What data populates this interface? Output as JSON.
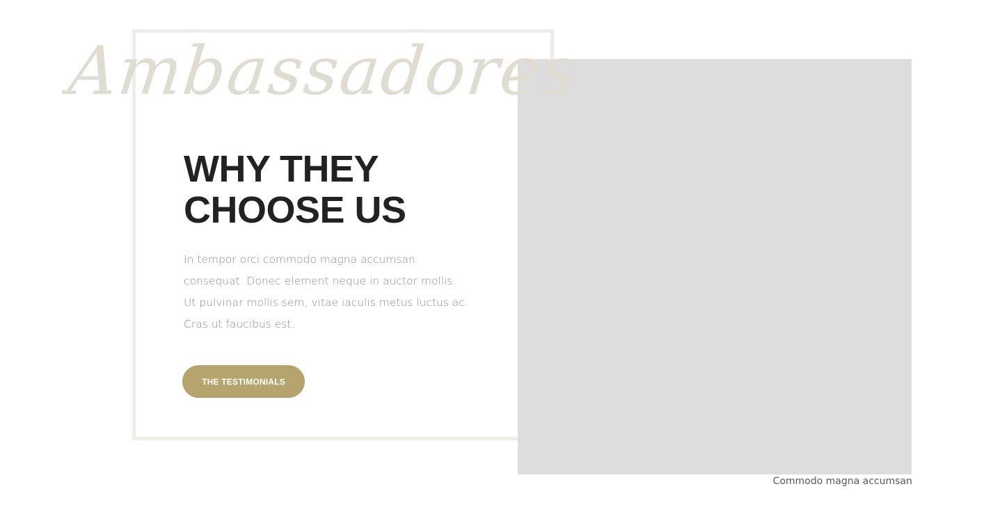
{
  "section": {
    "script_title": "Ambassadores",
    "heading_lines": [
      "WHY THEY",
      "CHOOSE US"
    ],
    "body_lines": [
      "In tempor orci commodo magna accumsan",
      "consequat. Donec element neque in auctor mollis.",
      "Ut pulvinar mollis sem, vitae iaculis metus luctus ac.",
      "Cras ut faucibus est."
    ],
    "cta_label": "THE TESTIMONIALS",
    "image_caption": "Commodo magna accumsan"
  },
  "colors": {
    "accent": "#b5a46d",
    "frame": "#efede7",
    "script": "#e0dcd2",
    "heading": "#222222",
    "body": "#8e8e8e",
    "image_placeholder": "#dddddd"
  }
}
